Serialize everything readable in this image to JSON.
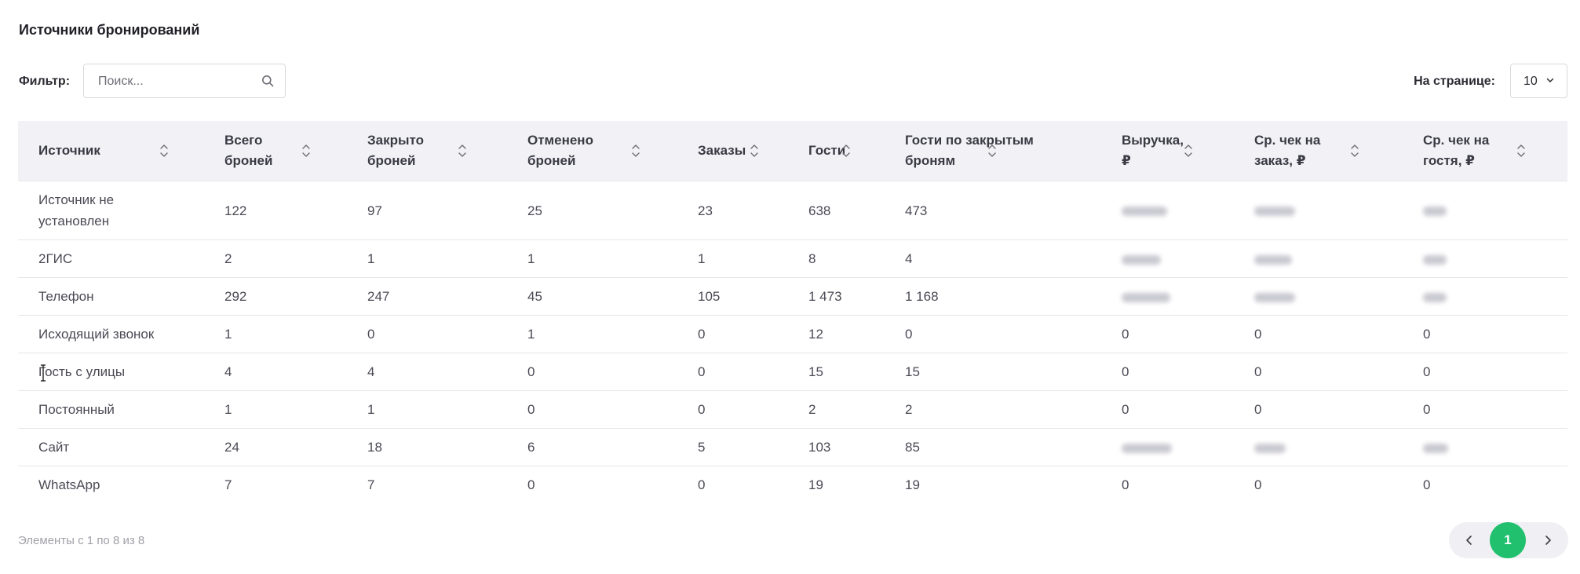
{
  "title": "Источники бронирований",
  "filter": {
    "label": "Фильтр:",
    "placeholder": "Поиск..."
  },
  "per_page": {
    "label": "На странице:",
    "value": "10"
  },
  "columns": [
    {
      "label_line1": "Источник",
      "label_line2": ""
    },
    {
      "label_line1": "Всего",
      "label_line2": "броней"
    },
    {
      "label_line1": "Закрыто",
      "label_line2": "броней"
    },
    {
      "label_line1": "Отменено",
      "label_line2": "броней"
    },
    {
      "label_line1": "Заказы",
      "label_line2": ""
    },
    {
      "label_line1": "Гости",
      "label_line2": ""
    },
    {
      "label_line1": "Гости по закрытым",
      "label_line2": "броням"
    },
    {
      "label_line1": "Выручка,",
      "label_line2": "₽"
    },
    {
      "label_line1": "Ср. чек на",
      "label_line2": "заказ, ₽"
    },
    {
      "label_line1": "Ср. чек на",
      "label_line2": "гостя, ₽"
    }
  ],
  "rows": [
    {
      "source_line1": "Источник не",
      "source_line2": "установлен",
      "total": "122",
      "closed": "97",
      "cancelled": "25",
      "orders": "23",
      "guests": "638",
      "guests_closed": "473",
      "revenue": "",
      "avg_order": "",
      "avg_guest": "",
      "revenue_hidden": true
    },
    {
      "source_line1": "2ГИС",
      "source_line2": "",
      "total": "2",
      "closed": "1",
      "cancelled": "1",
      "orders": "1",
      "guests": "8",
      "guests_closed": "4",
      "revenue": "",
      "avg_order": "",
      "avg_guest": "",
      "revenue_hidden": true
    },
    {
      "source_line1": "Телефон",
      "source_line2": "",
      "total": "292",
      "closed": "247",
      "cancelled": "45",
      "orders": "105",
      "guests": "1 473",
      "guests_closed": "1 168",
      "revenue": "",
      "avg_order": "",
      "avg_guest": "",
      "revenue_hidden": true
    },
    {
      "source_line1": "Исходящий звонок",
      "source_line2": "",
      "total": "1",
      "closed": "0",
      "cancelled": "1",
      "orders": "0",
      "guests": "12",
      "guests_closed": "0",
      "revenue": "0",
      "avg_order": "0",
      "avg_guest": "0",
      "revenue_hidden": false
    },
    {
      "source_line1": "Гость с улицы",
      "source_line2": "",
      "total": "4",
      "closed": "4",
      "cancelled": "0",
      "orders": "0",
      "guests": "15",
      "guests_closed": "15",
      "revenue": "0",
      "avg_order": "0",
      "avg_guest": "0",
      "revenue_hidden": false
    },
    {
      "source_line1": "Постоянный",
      "source_line2": "",
      "total": "1",
      "closed": "1",
      "cancelled": "0",
      "orders": "0",
      "guests": "2",
      "guests_closed": "2",
      "revenue": "0",
      "avg_order": "0",
      "avg_guest": "0",
      "revenue_hidden": false
    },
    {
      "source_line1": "Сайт",
      "source_line2": "",
      "total": "24",
      "closed": "18",
      "cancelled": "6",
      "orders": "5",
      "guests": "103",
      "guests_closed": "85",
      "revenue": "",
      "avg_order": "",
      "avg_guest": "",
      "revenue_hidden": true
    },
    {
      "source_line1": "WhatsApp",
      "source_line2": "",
      "total": "7",
      "closed": "7",
      "cancelled": "0",
      "orders": "0",
      "guests": "19",
      "guests_closed": "19",
      "revenue": "0",
      "avg_order": "0",
      "avg_guest": "0",
      "revenue_hidden": false
    }
  ],
  "footer": {
    "info": "Элементы с 1 по 8 из 8"
  },
  "pagination": {
    "current_page": "1"
  },
  "colors": {
    "accent": "#21c06e",
    "header_bg": "#f2f2f6",
    "border": "#e6e6ea"
  }
}
